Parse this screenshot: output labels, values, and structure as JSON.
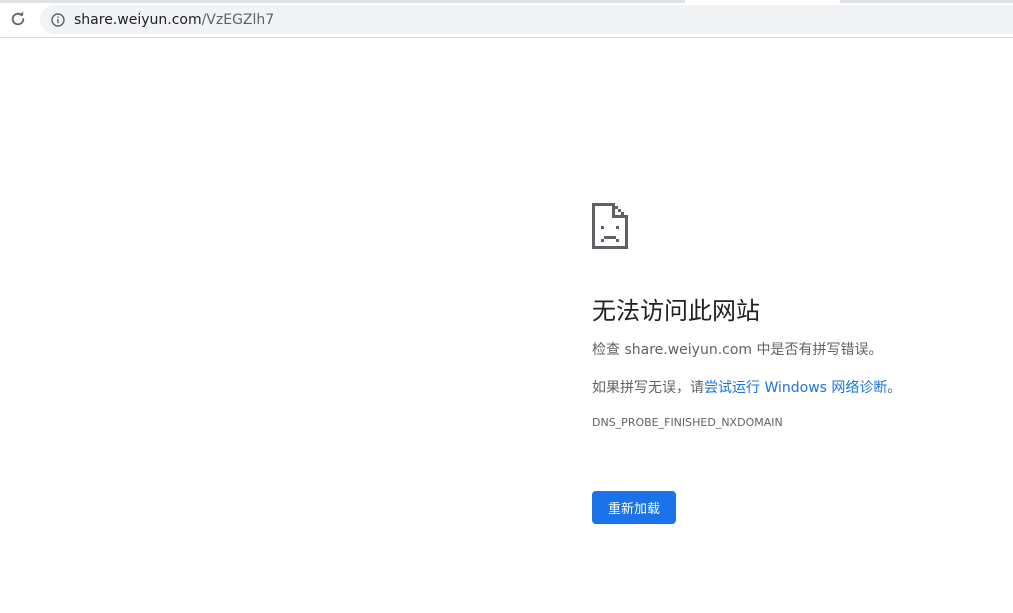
{
  "browser": {
    "reload_icon": "reload-icon",
    "info_icon": "info-icon",
    "url_host": "share.weiyun.com",
    "url_path": "/VzEGZlh7"
  },
  "error_page": {
    "icon": "sad-page-icon",
    "title": "无法访问此网站",
    "check_text": "检查 share.weiyun.com 中是否有拼写错误。",
    "hint_prefix": "如果拼写无误，请",
    "hint_link": "尝试运行 Windows 网络诊断",
    "hint_suffix": "。",
    "error_code": "DNS_PROBE_FINISHED_NXDOMAIN",
    "reload_button": "重新加载"
  },
  "colors": {
    "accent": "#1a73e8",
    "text_primary": "#202124",
    "text_secondary": "#5f6368",
    "omnibox_bg": "#f1f3f4"
  }
}
